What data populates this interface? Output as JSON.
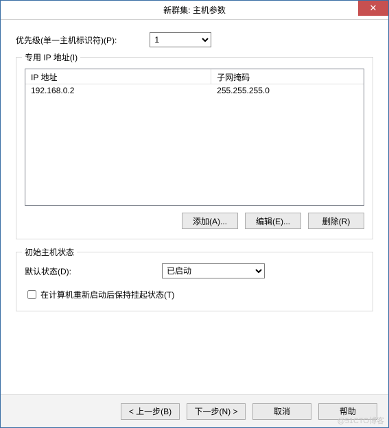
{
  "titlebar": {
    "title": "新群集: 主机参数"
  },
  "priority": {
    "label": "优先级(单一主机标识符)(P):",
    "value": "1",
    "options": [
      "1"
    ]
  },
  "ipSection": {
    "legend": "专用 IP 地址(I)",
    "columns": {
      "ip": "IP 地址",
      "mask": "子网掩码"
    },
    "rows": [
      {
        "ip": "192.168.0.2",
        "mask": "255.255.255.0"
      }
    ],
    "buttons": {
      "add": "添加(A)...",
      "edit": "编辑(E)...",
      "remove": "删除(R)"
    }
  },
  "stateSection": {
    "legend": "初始主机状态",
    "defaultLabel": "默认状态(D):",
    "defaultValue": "已启动",
    "options": [
      "已启动"
    ],
    "retainLabel": "在计算机重新启动后保持挂起状态(T)"
  },
  "footer": {
    "back": "< 上一步(B)",
    "next": "下一步(N) >",
    "cancel": "取消",
    "help": "帮助"
  },
  "watermark": "@51CTO博客"
}
